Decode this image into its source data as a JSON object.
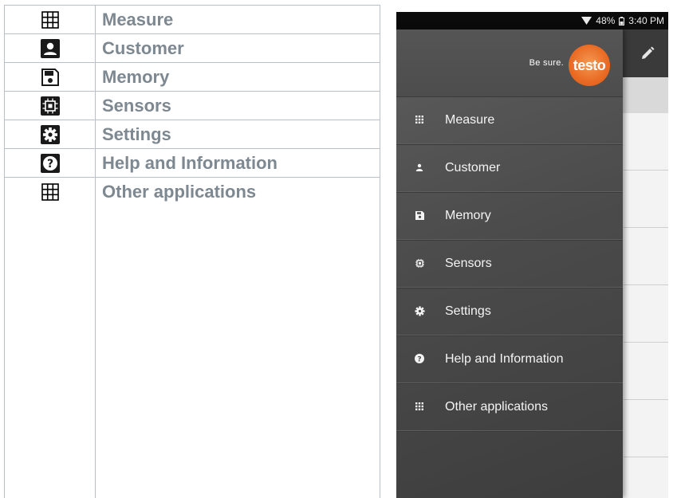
{
  "legend": {
    "rows": [
      {
        "icon": "grid-icon",
        "label": "Measure"
      },
      {
        "icon": "person-icon",
        "label": "Customer"
      },
      {
        "icon": "floppy-disk-icon",
        "label": "Memory"
      },
      {
        "icon": "chip-icon",
        "label": "Sensors"
      },
      {
        "icon": "gear-icon",
        "label": "Settings"
      },
      {
        "icon": "help-icon",
        "label": "Help and Information"
      },
      {
        "icon": "grid-icon",
        "label": "Other applications"
      }
    ]
  },
  "phone": {
    "status_bar": {
      "battery": "48%",
      "time": "3:40 PM"
    },
    "drawer": {
      "tagline": "Be sure.",
      "logo_text": "testo",
      "items": [
        {
          "icon": "grid-icon",
          "label": "Measure"
        },
        {
          "icon": "person-icon",
          "label": "Customer"
        },
        {
          "icon": "floppy-disk-icon",
          "label": "Memory"
        },
        {
          "icon": "chip-icon",
          "label": "Sensors"
        },
        {
          "icon": "gear-icon",
          "label": "Settings"
        },
        {
          "icon": "help-icon",
          "label": "Help and Information"
        },
        {
          "icon": "grid-icon",
          "label": "Other applications"
        }
      ]
    }
  },
  "colors": {
    "legend_text": "#7d8891",
    "legend_border": "#b9c0c7",
    "drawer_bg": "#4b4b4b",
    "brand_orange": "#ea6a23"
  }
}
